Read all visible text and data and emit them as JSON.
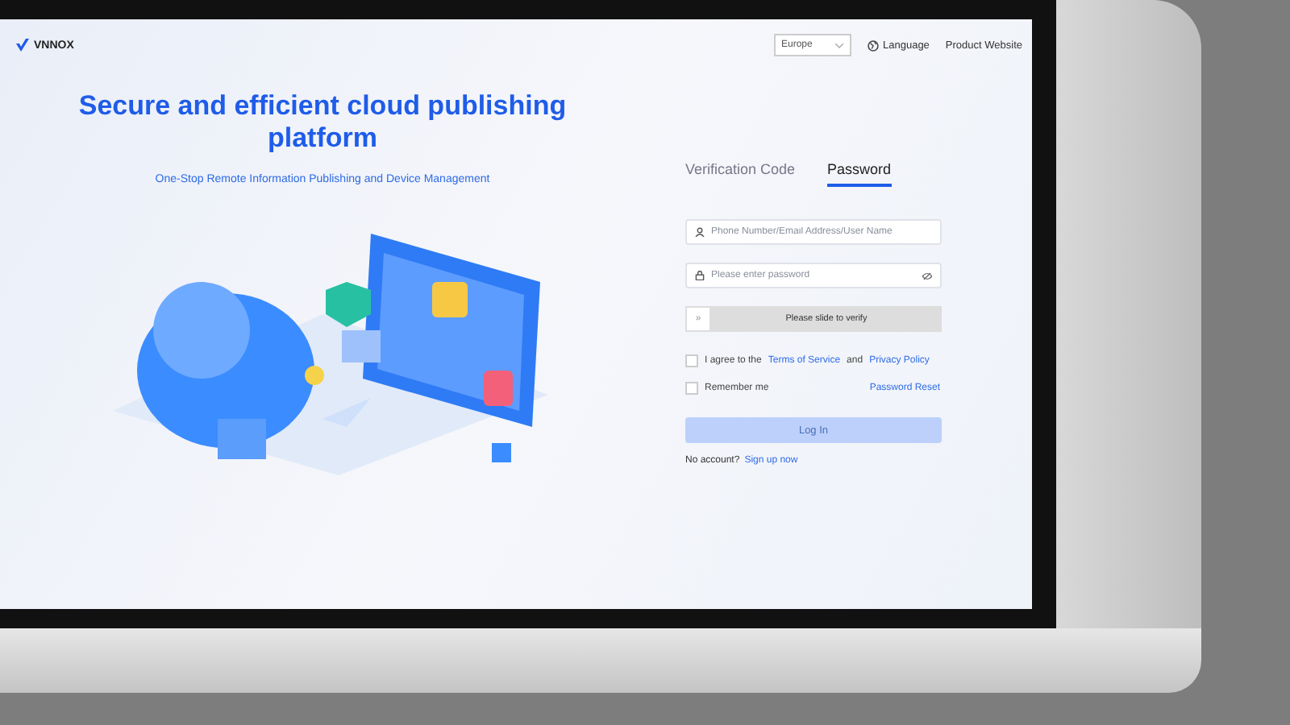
{
  "header": {
    "logo": "VNNOX",
    "region": "Europe",
    "language": "Language",
    "product_website": "Product Website"
  },
  "hero": {
    "title": "Secure and efficient cloud publishing platform",
    "subtitle": "One-Stop Remote Information Publishing and Device Management"
  },
  "login": {
    "tabs": [
      {
        "label": "Verification Code",
        "selected": false
      },
      {
        "label": "Password",
        "selected": true
      }
    ],
    "account_field": {
      "placeholder": "Phone Number/Email Address/User Name"
    },
    "password_field": {
      "placeholder": "Please enter password"
    },
    "slider": {
      "label": "Please slide to verify",
      "handle": "»"
    },
    "agreement": {
      "checked": false,
      "prefix": "I agree to the",
      "terms_link": "Terms of Service",
      "joiner": "and",
      "privacy_link": "Privacy Policy"
    },
    "remember": {
      "label": "Remember me",
      "checked": false
    },
    "password_reset": "Password Reset",
    "login_button": {
      "label": "Log In",
      "disabled": true
    },
    "signup": {
      "prompt": "No account?",
      "link": "Sign up now"
    }
  }
}
